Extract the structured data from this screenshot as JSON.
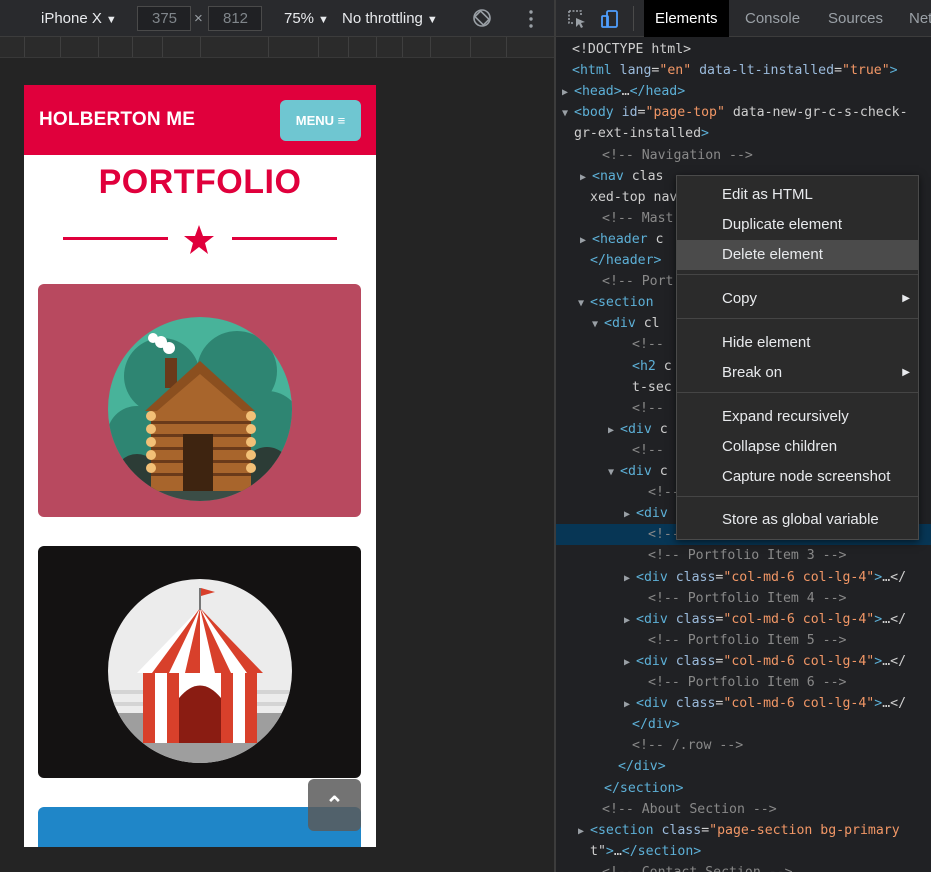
{
  "device_toolbar": {
    "device": "iPhone X",
    "width": "375",
    "times": "×",
    "height": "812",
    "zoom": "75%",
    "throttling": "No throttling",
    "caret": "▼"
  },
  "page": {
    "brand": "HOLBERTON ME",
    "menu_label": "MENU",
    "menu_icon": "≡",
    "section_title": "PORTFOLIO",
    "scroll_top_icon": "⌃",
    "colors": {
      "primary": "#e0003c",
      "menu_button": "#6fc6d1",
      "card1": "#b8495f",
      "card2": "#141212",
      "card3": "#1f86c8"
    }
  },
  "devtools": {
    "tabs": [
      "Elements",
      "Console",
      "Sources",
      "Net"
    ],
    "active_tab": "Elements",
    "dom_lines": [
      {
        "t": "<!DOCTYPE html>"
      },
      {
        "t": "<html lang=\"en\" data-lt-installed=\"true\">"
      },
      {
        "t": "<head>…</head>"
      },
      {
        "t": "<body id=\"page-top\" data-new-gr-c-s-check-"
      },
      {
        "t": "gr-ext-installed>"
      },
      {
        "t": "<!-- Navigation -->"
      },
      {
        "t": "<nav clas"
      },
      {
        "t": "xed-top nav"
      },
      {
        "t": "<!-- Mast"
      },
      {
        "t": "<header c"
      },
      {
        "t": "</header>"
      },
      {
        "t": "<!-- Port"
      },
      {
        "t": "<section"
      },
      {
        "t": "<div cl"
      },
      {
        "t": "<!--"
      },
      {
        "t": "<h2 c"
      },
      {
        "t": "t-sec"
      },
      {
        "t": "<!--"
      },
      {
        "t": "<div c"
      },
      {
        "t": "<!--"
      },
      {
        "t": "<div c"
      },
      {
        "t": "<!--"
      },
      {
        "t": "<div"
      },
      {
        "t": "<!--"
      },
      {
        "t": "<!-- Portfolio Item 3 -->"
      },
      {
        "t": "<div class=\"col-md-6 col-lg-4\">…</"
      },
      {
        "t": "<!-- Portfolio Item 4 -->"
      },
      {
        "t": "<div class=\"col-md-6 col-lg-4\">…</"
      },
      {
        "t": "<!-- Portfolio Item 5 -->"
      },
      {
        "t": "<div class=\"col-md-6 col-lg-4\">…</"
      },
      {
        "t": "<!-- Portfolio Item 6 -->"
      },
      {
        "t": "<div class=\"col-md-6 col-lg-4\">…</"
      },
      {
        "t": "</div>"
      },
      {
        "t": "<!-- /.row -->"
      },
      {
        "t": "</div>"
      },
      {
        "t": "</section>"
      },
      {
        "t": "<!-- About Section -->"
      },
      {
        "t": "<section class=\"page-section bg-primary"
      },
      {
        "t": "t\">…</section>"
      },
      {
        "t": "<!-- Contact Section -->"
      }
    ],
    "dots": "•••"
  },
  "context_menu": {
    "items": [
      "Edit as HTML",
      "Duplicate element",
      "Delete element",
      "Copy",
      "Hide element",
      "Break on",
      "Expand recursively",
      "Collapse children",
      "Capture node screenshot",
      "Store as global variable"
    ],
    "hovered": "Delete element",
    "submenu_arrow": "▶"
  }
}
